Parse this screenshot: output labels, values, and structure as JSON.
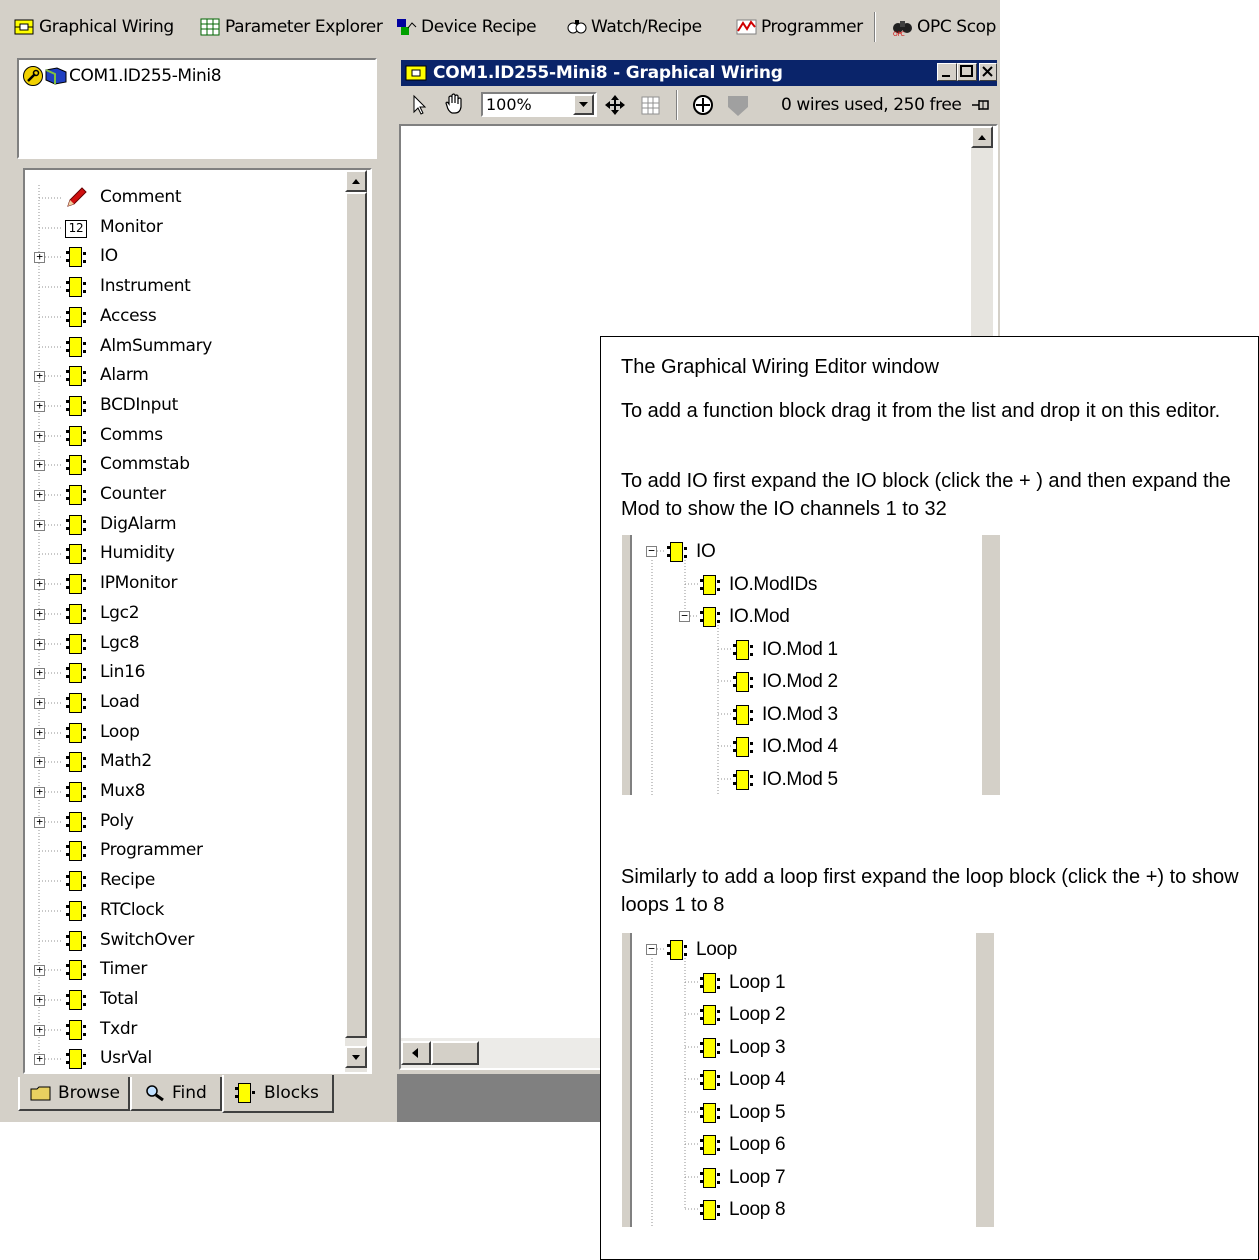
{
  "toolbar": {
    "items": [
      {
        "label": "Graphical Wiring",
        "icon": "graphical-wiring-icon"
      },
      {
        "label": "Parameter Explorer",
        "icon": "parameter-explorer-icon"
      },
      {
        "label": "Device Recipe",
        "icon": "device-recipe-icon"
      },
      {
        "label": "Watch/Recipe",
        "icon": "watch-recipe-icon"
      },
      {
        "label": "Programmer",
        "icon": "programmer-icon"
      },
      {
        "label": "OPC Scop",
        "icon": "opc-scope-icon"
      }
    ]
  },
  "device_panel": {
    "device": "COM1.ID255-Mini8"
  },
  "block_tree": {
    "items": [
      {
        "label": "Comment",
        "expandable": false,
        "icon": "pencil-icon"
      },
      {
        "label": "Monitor",
        "expandable": false,
        "icon": "monitor-12-icon"
      },
      {
        "label": "IO",
        "expandable": true
      },
      {
        "label": "Instrument",
        "expandable": false
      },
      {
        "label": "Access",
        "expandable": false
      },
      {
        "label": "AlmSummary",
        "expandable": false
      },
      {
        "label": "Alarm",
        "expandable": true
      },
      {
        "label": "BCDInput",
        "expandable": true
      },
      {
        "label": "Comms",
        "expandable": true
      },
      {
        "label": "Commstab",
        "expandable": true
      },
      {
        "label": "Counter",
        "expandable": true
      },
      {
        "label": "DigAlarm",
        "expandable": true
      },
      {
        "label": "Humidity",
        "expandable": false
      },
      {
        "label": "IPMonitor",
        "expandable": true
      },
      {
        "label": "Lgc2",
        "expandable": true
      },
      {
        "label": "Lgc8",
        "expandable": true
      },
      {
        "label": "Lin16",
        "expandable": true
      },
      {
        "label": "Load",
        "expandable": true
      },
      {
        "label": "Loop",
        "expandable": true
      },
      {
        "label": "Math2",
        "expandable": true
      },
      {
        "label": "Mux8",
        "expandable": true
      },
      {
        "label": "Poly",
        "expandable": true
      },
      {
        "label": "Programmer",
        "expandable": false
      },
      {
        "label": "Recipe",
        "expandable": false
      },
      {
        "label": "RTClock",
        "expandable": false
      },
      {
        "label": "SwitchOver",
        "expandable": false
      },
      {
        "label": "Timer",
        "expandable": true
      },
      {
        "label": "Total",
        "expandable": true
      },
      {
        "label": "Txdr",
        "expandable": true
      },
      {
        "label": "UsrVal",
        "expandable": true
      }
    ]
  },
  "tabs": [
    {
      "label": "Browse",
      "icon": "folder-icon",
      "active": false
    },
    {
      "label": "Find",
      "icon": "find-icon",
      "active": false
    },
    {
      "label": "Blocks",
      "icon": "block-icon",
      "active": true
    }
  ],
  "editor": {
    "title": "COM1.ID255-Mini8 - Graphical Wiring",
    "zoom": "100%",
    "wire_status": "0 wires used, 250 free"
  },
  "note": {
    "heading": "The Graphical Wiring Editor window",
    "para1": "To add a function block drag it from the list and drop it on this editor.",
    "para2": "To add IO first expand the IO block (click the + ) and then expand the Mod to show the IO channels 1 to 32",
    "para3": "Similarly to add a loop first expand the loop block (click the +) to show loops 1 to 8",
    "io_tree": [
      "IO",
      "IO.ModIDs",
      "IO.Mod",
      "IO.Mod 1",
      "IO.Mod 2",
      "IO.Mod 3",
      "IO.Mod 4",
      "IO.Mod 5"
    ],
    "loop_tree": [
      "Loop",
      "Loop 1",
      "Loop 2",
      "Loop 3",
      "Loop 4",
      "Loop 5",
      "Loop 6",
      "Loop 7",
      "Loop 8"
    ]
  }
}
